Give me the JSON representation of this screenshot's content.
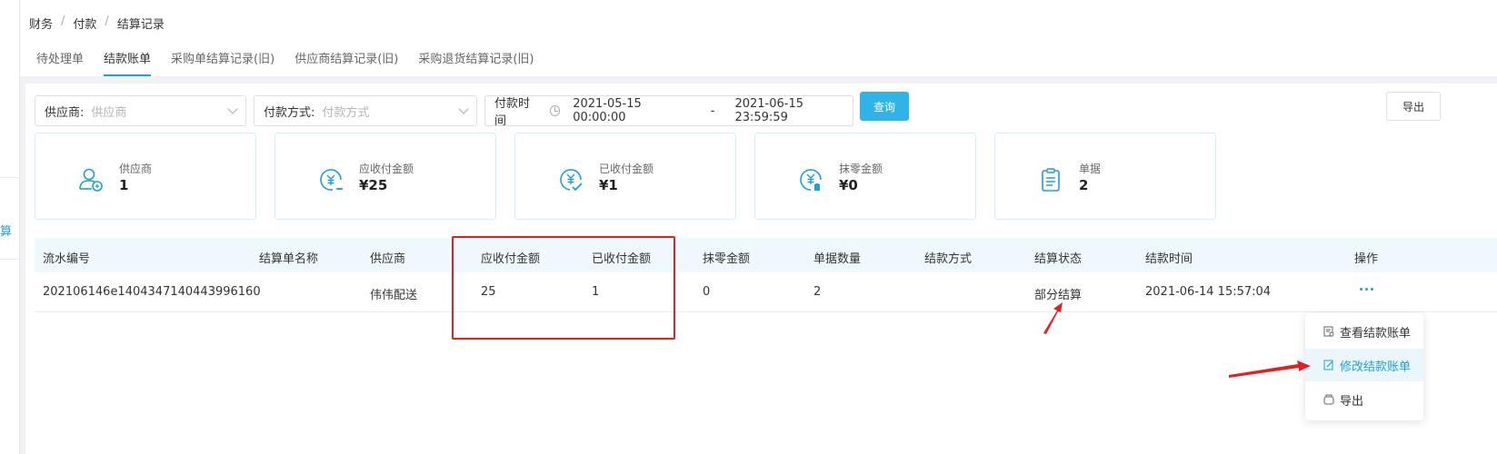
{
  "left_sidebar": {
    "partial_label": "算"
  },
  "breadcrumb": [
    "财务",
    "付款",
    "结算记录"
  ],
  "breadcrumb_sep": "/",
  "tabs": [
    {
      "label": "待处理单",
      "active": false
    },
    {
      "label": "结款账单",
      "active": true
    },
    {
      "label": "采购单结算记录(旧)",
      "active": false
    },
    {
      "label": "供应商结算记录(旧)",
      "active": false
    },
    {
      "label": "采购退货结算记录(旧)",
      "active": false
    }
  ],
  "filters": {
    "supplier": {
      "label": "供应商:",
      "placeholder": "供应商"
    },
    "payment_method": {
      "label": "付款方式:",
      "placeholder": "付款方式"
    },
    "payment_time": {
      "label": "付款时间",
      "start": "2021-05-15 00:00:00",
      "separator": "-",
      "end": "2021-06-15 23:59:59"
    }
  },
  "buttons": {
    "query": "查询",
    "export": "导出"
  },
  "summary_cards": [
    {
      "label": "供应商",
      "value": "1",
      "icon": "supplier-icon"
    },
    {
      "label": "应收付金额",
      "value": "¥25",
      "icon": "receivable-icon"
    },
    {
      "label": "已收付金额",
      "value": "¥1",
      "icon": "paid-icon"
    },
    {
      "label": "抹零金额",
      "value": "¥0",
      "icon": "rounding-icon"
    },
    {
      "label": "单据",
      "value": "2",
      "icon": "document-icon"
    }
  ],
  "table": {
    "columns": [
      "流水编号",
      "结算单名称",
      "供应商",
      "应收付金额",
      "已收付金额",
      "抹零金额",
      "单据数量",
      "结款方式",
      "结算状态",
      "结款时间",
      "操作"
    ],
    "rows": [
      {
        "serial": "202106146e1404347140443996160",
        "name": "",
        "supplier": "伟伟配送",
        "receivable": "25",
        "paid": "1",
        "rounding": "0",
        "doc_count": "2",
        "method": "",
        "status": "部分结算",
        "time": "2021-06-14 15:57:04"
      }
    ]
  },
  "action_menu": [
    {
      "label": "查看结款账单",
      "active": false
    },
    {
      "label": "修改结款账单",
      "active": true
    },
    {
      "label": "导出",
      "active": false
    }
  ],
  "colors": {
    "accent": "#1e9fd8",
    "annotation": "#e61e1e",
    "query_button": "#2fb3e8"
  }
}
